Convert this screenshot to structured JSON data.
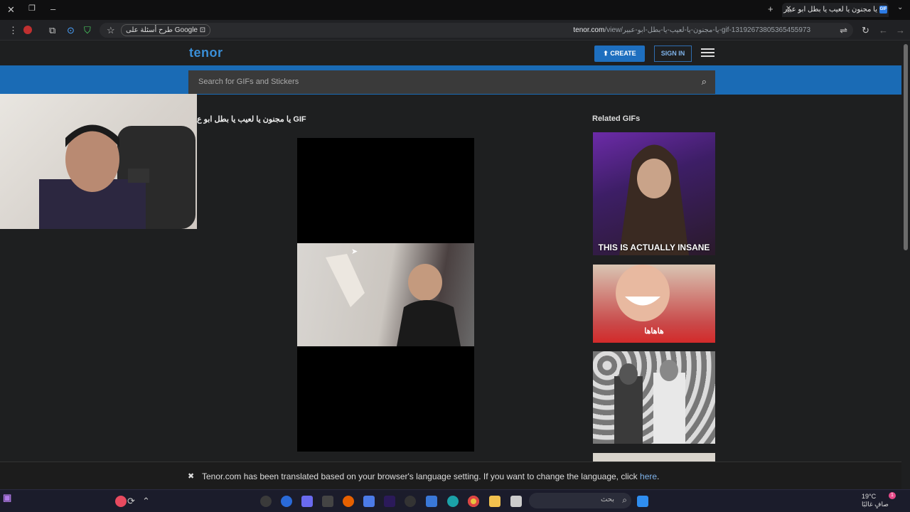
{
  "browser": {
    "tab_title": "يا مجنون يا لعيب يا بطل ابو عبير",
    "tab_favicon": "GIF",
    "url_domain": "tenor.com",
    "url_path": "/view/يا-مجنون-يا-لعيب-يا-بطل-ابو-عبير-gif-13192673805365455973",
    "google_chip": "طرح أسئلة على Google"
  },
  "tenor": {
    "logo": "tenor",
    "create_label": "CREATE",
    "signin_label": "SIGN IN",
    "search_placeholder": "Search for GIFs and Stickers",
    "gif_title": "يا مجنون يا لعيب يا بطل ابو ع GIF",
    "related_title": "Related GIFs",
    "related": [
      {
        "caption": "THIS IS ACTUALLY INSANE"
      },
      {
        "caption": "هاهاها"
      },
      {
        "caption": ""
      }
    ],
    "notice_text": "Tenor.com has been translated based on your browser's language setting. If you want to change the language, click ",
    "notice_link": "here",
    "notice_end": "."
  },
  "taskbar": {
    "search_placeholder": "بحث",
    "weather_temp": "19°C",
    "weather_desc": "صافٍ غالبًا",
    "notification_count": "1"
  },
  "colors": {
    "tenor_blue": "#1a6bb5",
    "create_bg": "#1e6fbf",
    "page_bg": "#1e1f20"
  }
}
